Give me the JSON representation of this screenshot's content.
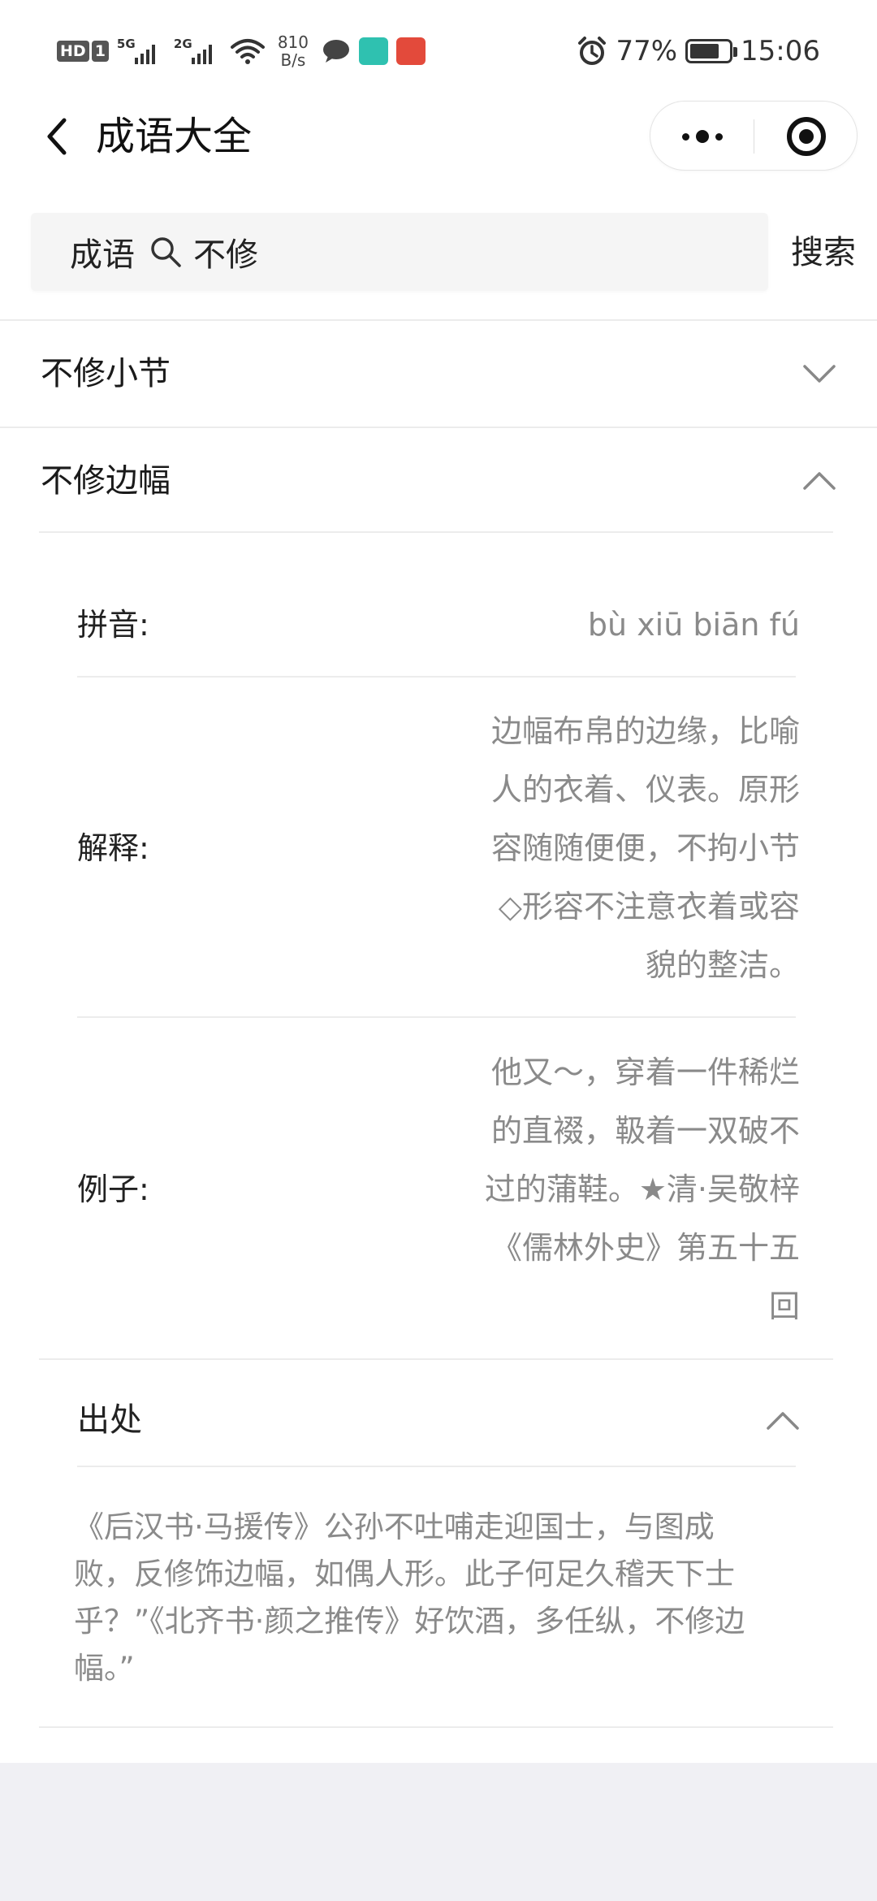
{
  "status_bar": {
    "hd_label": "HD",
    "sim_label": "1",
    "net1": "5G",
    "net2": "2G",
    "speed_value": "810",
    "speed_unit": "B/s",
    "boss_app_label": "BOSS直聘",
    "battery_percent": "77%",
    "battery_level": 0.77,
    "time": "15:06"
  },
  "nav": {
    "title": "成语大全"
  },
  "search": {
    "prefix": "成语",
    "value": "不修",
    "button_label": "搜索"
  },
  "results": [
    {
      "title": "不修小节",
      "expanded": false
    },
    {
      "title": "不修边幅",
      "expanded": true,
      "details": {
        "pinyin_label": "拼音:",
        "pinyin": "bù xiū biān fú",
        "meaning_label": "解释:",
        "meaning_lines": [
          "边幅布帛的边缘，比喻",
          "人的衣着、仪表。原形",
          "容随随便便，不拘小节",
          "◇形容不注意衣着或容",
          "貌的整洁。"
        ],
        "example_label": "例子:",
        "example_lines": [
          "他又～，穿着一件稀烂",
          "的直裰，靸着一双破不",
          "过的蒲鞋。★清·吴敬梓",
          "《儒林外史》第五十五",
          "回"
        ],
        "source_label": "出处",
        "source_expanded": true,
        "source_lines": [
          "《后汉书·马援传》公孙不吐哺走迎国士，与图成",
          "败，反修饰边幅，如偶人形。此子何足久稽天下士",
          "乎？”《北齐书·颜之推传》好饮酒，多任纵，不修边",
          "幅。”"
        ]
      }
    }
  ]
}
